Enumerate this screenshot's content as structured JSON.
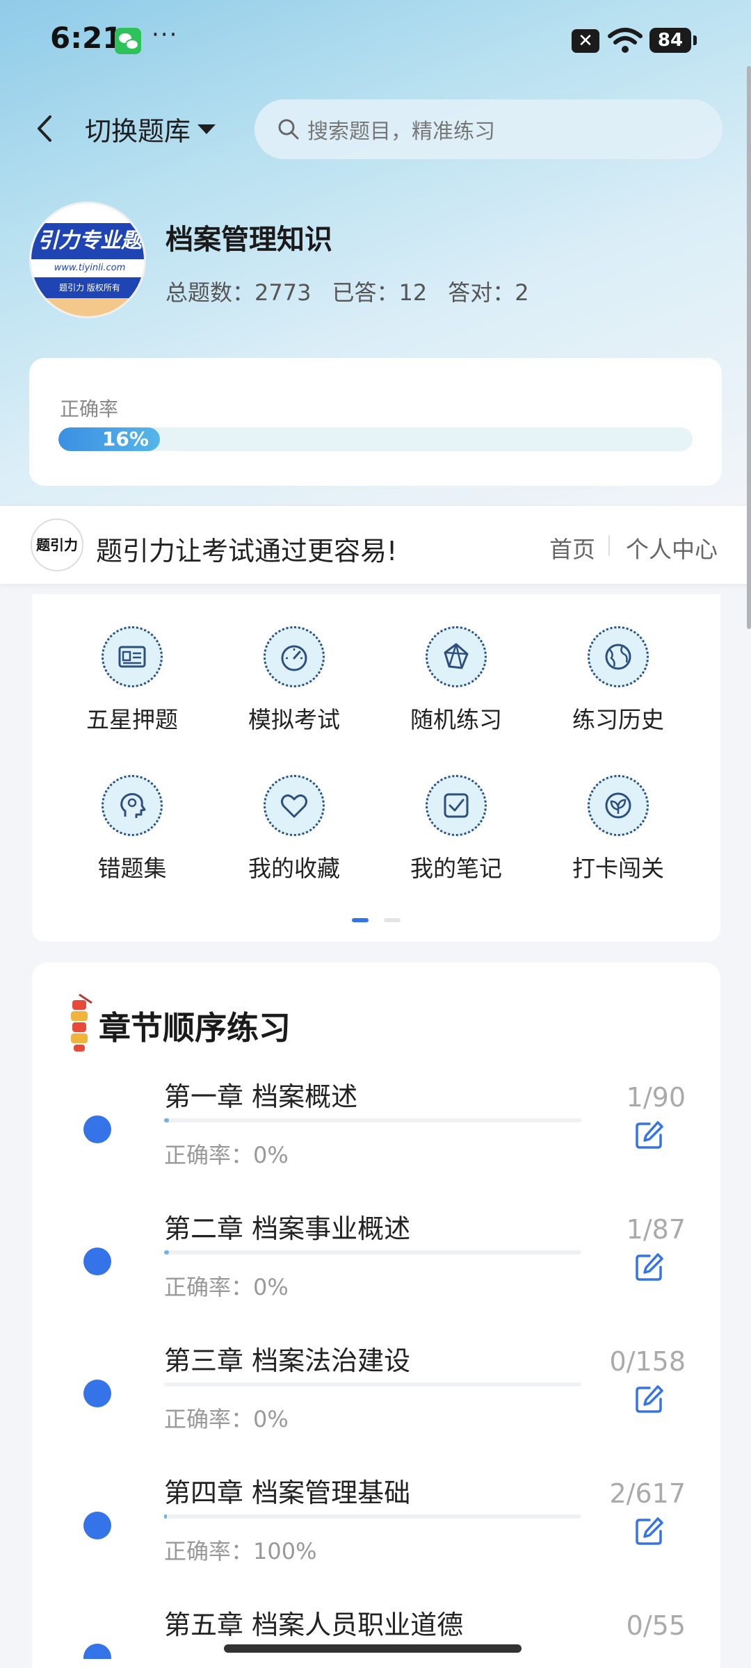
{
  "status": {
    "time": "6:21",
    "more": "···",
    "battery": "84"
  },
  "nav": {
    "switch_label": "切换题库"
  },
  "search": {
    "placeholder": "搜索题目，精准练习"
  },
  "bank": {
    "logo_text": "引力专业题",
    "logo_url": "www.tiyinli.com",
    "logo_copyright": "题引力 版权所有",
    "title": "档案管理知识",
    "total_label": "总题数：2773",
    "answered_label": "已答：12",
    "correct_label": "答对：2"
  },
  "accuracy": {
    "label": "正确率",
    "value_text": "16%",
    "value": 16
  },
  "promo": {
    "logo_text": "题引力",
    "text": "题引力让考试通过更容易!",
    "home": "首页",
    "user_center": "个人中心"
  },
  "grid": [
    {
      "label": "五星押题",
      "icon": "id-card-icon"
    },
    {
      "label": "模拟考试",
      "icon": "gauge-icon"
    },
    {
      "label": "随机练习",
      "icon": "random-icon"
    },
    {
      "label": "练习历史",
      "icon": "globe-icon"
    },
    {
      "label": "错题集",
      "icon": "head-icon"
    },
    {
      "label": "我的收藏",
      "icon": "heart-icon"
    },
    {
      "label": "我的笔记",
      "icon": "checkbox-icon"
    },
    {
      "label": "打卡闯关",
      "icon": "leaf-icon"
    }
  ],
  "chapters_section": {
    "title": "章节顺序练习"
  },
  "chapters": [
    {
      "name": "第一章 档案概述",
      "accuracy": "正确率：0%",
      "count": "1/90",
      "progress": 0.011
    },
    {
      "name": "第二章 档案事业概述",
      "accuracy": "正确率：0%",
      "count": "1/87",
      "progress": 0.011
    },
    {
      "name": "第三章 档案法治建设",
      "accuracy": "正确率：0%",
      "count": "0/158",
      "progress": 0
    },
    {
      "name": "第四章 档案管理基础",
      "accuracy": "正确率：100%",
      "count": "2/617",
      "progress": 0.003
    },
    {
      "name": "第五章 档案人员职业道德",
      "accuracy": "",
      "count": "0/55",
      "progress": 0
    }
  ],
  "colors": {
    "accent": "#3473e8",
    "bar": "#3c8fe3"
  }
}
